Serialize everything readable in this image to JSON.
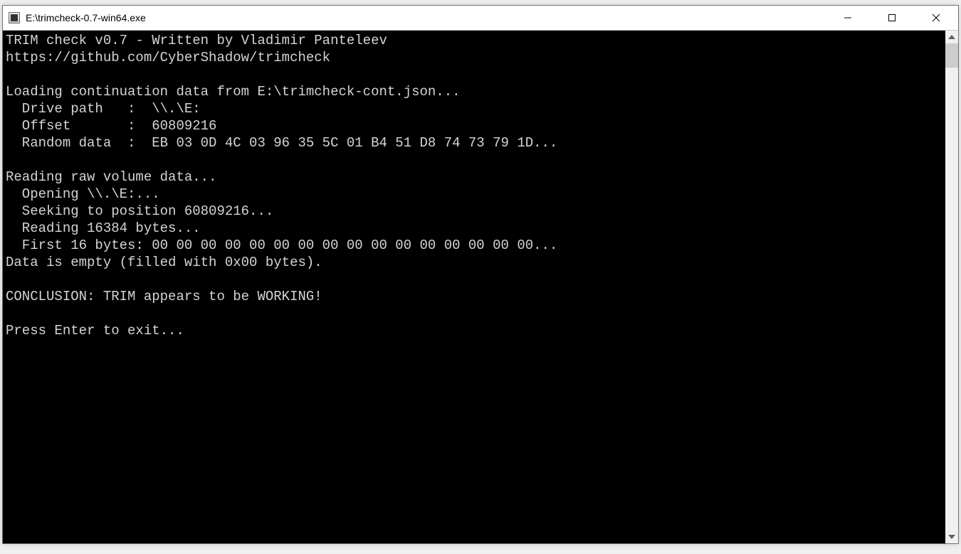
{
  "window": {
    "title": "E:\\trimcheck-0.7-win64.exe"
  },
  "console": {
    "lines": [
      "TRIM check v0.7 - Written by Vladimir Panteleev",
      "https://github.com/CyberShadow/trimcheck",
      "",
      "Loading continuation data from E:\\trimcheck-cont.json...",
      "  Drive path   :  \\\\.\\E:",
      "  Offset       :  60809216",
      "  Random data  :  EB 03 0D 4C 03 96 35 5C 01 B4 51 D8 74 73 79 1D...",
      "",
      "Reading raw volume data...",
      "  Opening \\\\.\\E:...",
      "  Seeking to position 60809216...",
      "  Reading 16384 bytes...",
      "  First 16 bytes: 00 00 00 00 00 00 00 00 00 00 00 00 00 00 00 00...",
      "Data is empty (filled with 0x00 bytes).",
      "",
      "CONCLUSION: TRIM appears to be WORKING!",
      "",
      "Press Enter to exit..."
    ]
  }
}
